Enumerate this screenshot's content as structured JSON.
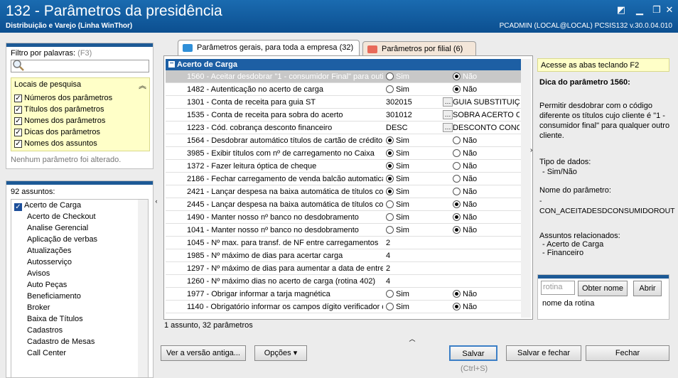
{
  "window": {
    "title": "132 - Parâmetros da presidência",
    "subtitle": "Distribuição e Varejo (Linha WinThor)",
    "connection": "PCADMIN (LOCAL@LOCAL)   PCSIS132  v.30.0.04.010"
  },
  "filter": {
    "label": "Filtro por palavras:",
    "shortcut": "(F3)",
    "value": "",
    "locais_title": "Locais de pesquisa",
    "options": [
      {
        "label": "Números dos parâmetros",
        "checked": true
      },
      {
        "label": "Títulos dos parâmetros",
        "checked": true
      },
      {
        "label": "Nomes dos parâmetros",
        "checked": true
      },
      {
        "label": "Dicas dos parâmetros",
        "checked": true
      },
      {
        "label": "Nomes dos assuntos",
        "checked": true
      }
    ],
    "status": "Nenhum parâmetro foi alterado."
  },
  "subjects": {
    "count_label": "92 assuntos:",
    "items": [
      "Acerto de Carga",
      "Acerto de Checkout",
      "Analise Gerencial",
      "Aplicação de verbas",
      "Atualizações",
      "Autosserviço",
      "Avisos",
      "Auto Peças",
      "Beneficiamento",
      "Broker",
      "Baixa de Títulos",
      "Cadastros",
      "Cadastro de Mesas",
      "Call Center"
    ],
    "selected": "Acerto de Carga"
  },
  "tabs": [
    {
      "label": "Parâmetros gerais, para toda a empresa",
      "count": "(32)",
      "active": true
    },
    {
      "label": "Parâmetros por filial",
      "count": "(6)",
      "active": false
    }
  ],
  "grid": {
    "group": "Acerto de Carga",
    "rows": [
      {
        "label": "1560 - Aceitar desdobrar \"1 - consumidor Final\" para outi",
        "type": "radio",
        "value": "Não",
        "highlight": true
      },
      {
        "label": "1482 - Autenticação no acerto de carga",
        "type": "radio",
        "value": "Não"
      },
      {
        "label": "1301 - Conta de receita para guia ST",
        "type": "lookup",
        "code": "302015",
        "desc": "GUIA SUBSTITUIÇ"
      },
      {
        "label": "1535 - Conta de receita para sobra do acerto",
        "type": "lookup",
        "code": "301012",
        "desc": "SOBRA ACERTO C"
      },
      {
        "label": "1223 - Cód. cobrança desconto financeiro",
        "type": "lookup",
        "code": "DESC",
        "desc": "DESCONTO CONC"
      },
      {
        "label": "1564 - Desdobrar automático títulos de cartão de crédito,",
        "type": "radio",
        "value": "Sim"
      },
      {
        "label": "3985 - Exibir títulos com nº de carregamento no Caixa",
        "type": "radio",
        "value": "Sim"
      },
      {
        "label": "1372 - Fazer leitura óptica de cheque",
        "type": "radio",
        "value": "Sim"
      },
      {
        "label": "2186 - Fechar carregamento de venda balcão automatica",
        "type": "radio",
        "value": "Sim"
      },
      {
        "label": "2421 - Lançar despesa na baixa automática de títulos con",
        "type": "radio",
        "value": "Sim"
      },
      {
        "label": "2445 - Lançar despesa na baixa automática de títulos con",
        "type": "radio",
        "value": "Não"
      },
      {
        "label": "1490 - Manter nosso nº banco no desdobramento",
        "type": "radio",
        "value": "Não"
      },
      {
        "label": "1041 - Manter nosso nº banco no desdobramento",
        "type": "radio",
        "value": "Não"
      },
      {
        "label": "1045 - Nº max. para transf. de NF entre carregamentos",
        "type": "text",
        "value": "2"
      },
      {
        "label": "1985 - Nº máximo de dias para acertar carga",
        "type": "text",
        "value": "4"
      },
      {
        "label": "1297 - Nº máximo de dias para aumentar a data de entre",
        "type": "text",
        "value": "2"
      },
      {
        "label": "1260 - Nº máximo dias no acerto de carga (rotina 402)",
        "type": "text",
        "value": "4"
      },
      {
        "label": "1977 - Obrigar informar a tarja magnética",
        "type": "radio",
        "value": "Não"
      },
      {
        "label": "1140 - Obrigatório informar os campos dígito verificador c",
        "type": "radio",
        "value": "Não"
      }
    ],
    "yes_label": "Sim",
    "no_label": "Não",
    "status": "1 assunto, 32 parâmetros"
  },
  "tip": {
    "header": "Acesse as abas teclando F2",
    "title": "Dica do parâmetro 1560:",
    "text": "Permitir desdobrar com o código diferente os títulos cujo cliente é \"1 - consumidor final\" para qualquer outro cliente.",
    "type_label": "Tipo de dados:",
    "type_value": "- Sim/Não",
    "name_label": "Nome do parâmetro:",
    "name_value": "- CON_ACEITADESDCONSUMIDOROUT",
    "related_label": "Assuntos relacionados:",
    "related": [
      "- Acerto de Carga",
      "- Financeiro"
    ]
  },
  "rotina": {
    "placeholder": "rotina",
    "get_name": "Obter nome",
    "open": "Abrir",
    "label": "nome da rotina"
  },
  "footer": {
    "old_version": "Ver a versão antiga...",
    "options": "Opções",
    "save": "Salvar",
    "save_shortcut": "(Ctrl+S)",
    "save_close": "Salvar e fechar",
    "close": "Fechar"
  }
}
